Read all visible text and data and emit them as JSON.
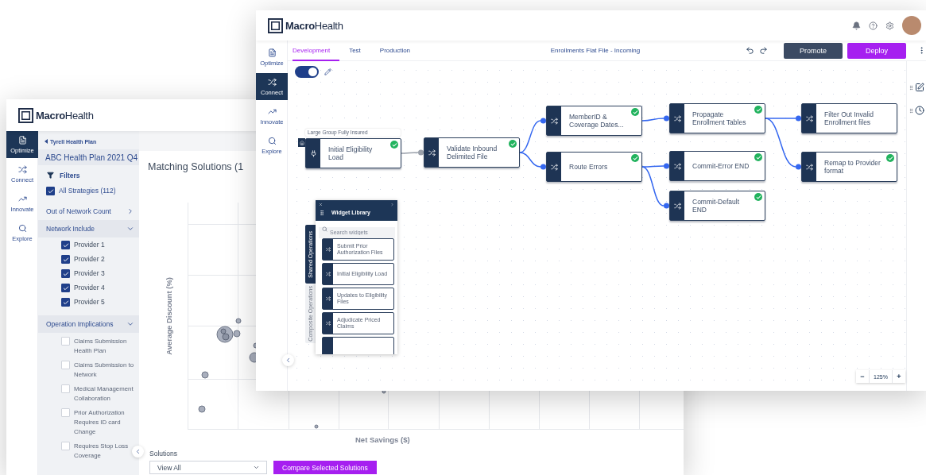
{
  "back_window": {
    "logo": {
      "bold": "Macro",
      "light": "Health"
    },
    "nav": [
      {
        "label": "Optimize",
        "kind": "report",
        "selected": true
      },
      {
        "label": "Connect",
        "kind": "shuffle",
        "selected": false
      },
      {
        "label": "Innovate",
        "kind": "trend",
        "selected": false
      },
      {
        "label": "Explore",
        "kind": "search",
        "selected": false
      }
    ],
    "breadcrumb": "Tyrell Health Plan",
    "plan": "ABC Health Plan 2021 Q4",
    "filters_label": "Filters",
    "all_strategies": {
      "label": "All Strategies (112)",
      "checked": true
    },
    "sections": [
      {
        "title": "Out of Network Count",
        "expanded": false
      },
      {
        "title": "Network Include",
        "expanded": true,
        "options": [
          {
            "label": "Provider 1",
            "checked": true
          },
          {
            "label": "Provider 2",
            "checked": true
          },
          {
            "label": "Provider 3",
            "checked": true
          },
          {
            "label": "Provider 4",
            "checked": true
          },
          {
            "label": "Provider 5",
            "checked": true
          }
        ]
      },
      {
        "title": "Operation Implications",
        "expanded": true,
        "options": [
          {
            "label": "Claims Submission Health Plan",
            "checked": false
          },
          {
            "label": "Claims Submission to Network",
            "checked": false
          },
          {
            "label": "Medical Management Collaboration",
            "checked": false
          },
          {
            "label": "Prior Authorization Requires ID card Change",
            "checked": false
          },
          {
            "label": "Requires Stop Loss Coverage",
            "checked": false
          }
        ]
      }
    ],
    "main": {
      "title": "Matching Solutions (1",
      "ylabel": "Average Discount (%)",
      "xlabel": "Net Savings ($)",
      "solutions_label": "Solutions",
      "solutions_value": "View All",
      "compare_button": "Compare Selected Solutions"
    }
  },
  "front_window": {
    "logo": {
      "bold": "Macro",
      "light": "Health"
    },
    "nav": [
      {
        "label": "Optimize",
        "kind": "report",
        "selected": false
      },
      {
        "label": "Connect",
        "kind": "shuffle",
        "selected": true
      },
      {
        "label": "Innovate",
        "kind": "trend",
        "selected": false
      },
      {
        "label": "Explore",
        "kind": "search",
        "selected": false
      }
    ],
    "tabs": [
      {
        "label": "Development",
        "selected": true
      },
      {
        "label": "Test",
        "selected": false
      },
      {
        "label": "Production",
        "selected": false
      }
    ],
    "flow_title": "Enrollments Flat File - Incoming",
    "buttons": [
      {
        "label": "Promote",
        "kind": "secondary"
      },
      {
        "label": "Deploy",
        "kind": "primary"
      }
    ],
    "edit_mode": {
      "on": true
    },
    "nodes": [
      {
        "label": "Initial Eligibility Load",
        "kind": "source",
        "valid": true,
        "tag": "Large Group Fully Insured"
      },
      {
        "label": "Validate Inbound Delimited File",
        "kind": "operation",
        "valid": true
      },
      {
        "label": "MemberID & Coverage Dates...",
        "kind": "operation",
        "valid": true
      },
      {
        "label": "Route Errors",
        "kind": "operation",
        "valid": true
      },
      {
        "label": "Propagate Enrollment Tables",
        "kind": "operation",
        "valid": true
      },
      {
        "label": "Commit-Error END",
        "kind": "operation",
        "valid": true
      },
      {
        "label": "Commit-Default END",
        "kind": "operation",
        "valid": true
      },
      {
        "label": "Filter Out Invalid Enrollment files",
        "kind": "operation",
        "valid": false
      },
      {
        "label": "Remap to Provider format",
        "kind": "operation",
        "valid": true
      }
    ],
    "widget_library": {
      "title": "Widget Library",
      "search_placeholder": "Search widgets",
      "tabs": [
        {
          "label": "Shared Operations",
          "selected": true
        },
        {
          "label": "Composite Operations",
          "selected": false
        }
      ],
      "items": [
        "Submit Prior Authorization Files",
        "Initial Eligibility Load",
        "Updates to Eligibility Files",
        "Adjudicate Priced Claims"
      ]
    },
    "zoom": {
      "minus": "−",
      "value": "125%",
      "plus": "+"
    }
  }
}
